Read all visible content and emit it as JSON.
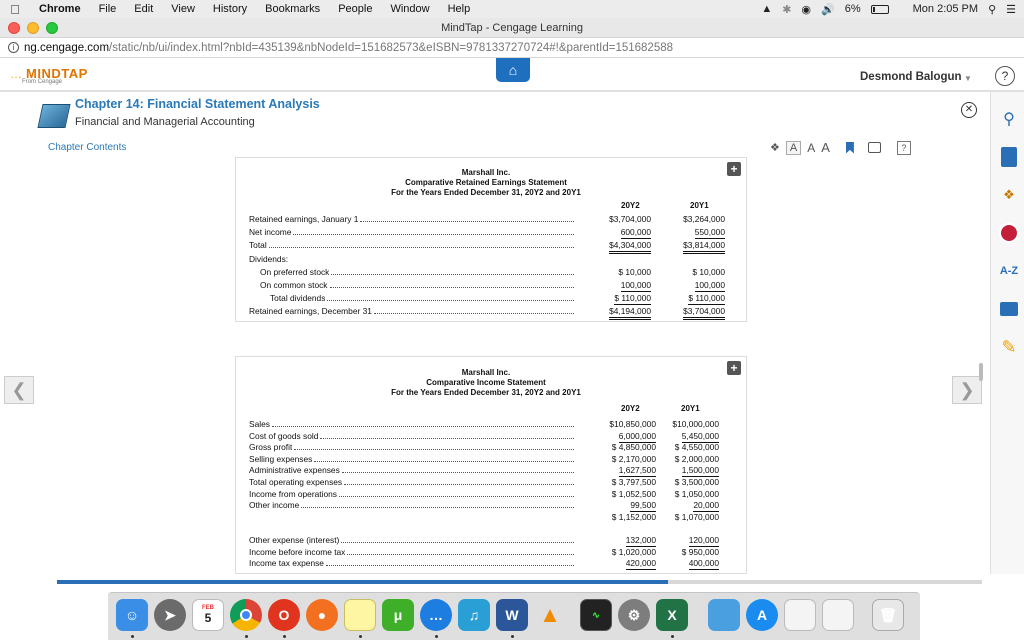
{
  "menubar": {
    "app": "Chrome",
    "items": [
      "File",
      "Edit",
      "View",
      "History",
      "Bookmarks",
      "People",
      "Window",
      "Help"
    ],
    "battery_pct": "6%",
    "clock": "Mon 2:05 PM"
  },
  "window": {
    "title": "MindTap - Cengage Learning"
  },
  "address": {
    "host": "ng.cengage.com",
    "path": "/static/nb/ui/index.html?nbId=435139&nbNodeId=151682573&eISBN=9781337270724#!&parentId=151682588"
  },
  "header": {
    "logo": "MINDTAP",
    "logo_sub": "From Cengage",
    "user": "Desmond Balogun",
    "help": "?"
  },
  "chapter": {
    "title": "Chapter 14: Financial Statement Analysis",
    "subtitle": "Financial and Managerial Accounting",
    "contents_link": "Chapter Contents"
  },
  "reader": {
    "font_sizes": [
      "A",
      "A",
      "A"
    ],
    "help": "?"
  },
  "retained": {
    "company": "Marshall Inc.",
    "title": "Comparative Retained Earnings Statement",
    "period": "For the Years Ended December 31, 20Y2 and 20Y1",
    "col1": "20Y2",
    "col2": "20Y1",
    "rows": [
      {
        "label": "Retained earnings, January 1",
        "v1": "$3,704,000",
        "v2": "$3,264,000"
      },
      {
        "label": "Net income",
        "v1": "600,000",
        "v2": "550,000"
      },
      {
        "label": "Total",
        "v1": "$4,304,000",
        "v2": "$3,814,000"
      },
      {
        "label": "Dividends:",
        "v1": "",
        "v2": ""
      },
      {
        "label": "On preferred stock",
        "v1": "$      10,000",
        "v2": "$      10,000"
      },
      {
        "label": "On common stock",
        "v1": "100,000",
        "v2": "100,000"
      },
      {
        "label": "Total dividends",
        "v1": "$   110,000",
        "v2": "$   110,000"
      },
      {
        "label": "Retained earnings, December 31",
        "v1": "$4,194,000",
        "v2": "$3,704,000"
      }
    ]
  },
  "income": {
    "company": "Marshall Inc.",
    "title": "Comparative Income Statement",
    "period": "For the Years Ended December 31, 20Y2 and 20Y1",
    "col1": "20Y2",
    "col2": "20Y1",
    "rows": [
      {
        "label": "Sales",
        "v1": "$10,850,000",
        "v2": "$10,000,000"
      },
      {
        "label": "Cost of goods sold",
        "v1": "6,000,000",
        "v2": "5,450,000"
      },
      {
        "label": "Gross profit",
        "v1": "$ 4,850,000",
        "v2": "$ 4,550,000"
      },
      {
        "label": "Selling expenses",
        "v1": "$ 2,170,000",
        "v2": "$ 2,000,000"
      },
      {
        "label": "Administrative expenses",
        "v1": "1,627,500",
        "v2": "1,500,000"
      },
      {
        "label": "Total operating expenses",
        "v1": "$ 3,797,500",
        "v2": "$ 3,500,000"
      },
      {
        "label": "Income from operations",
        "v1": "$ 1,052,500",
        "v2": "$ 1,050,000"
      },
      {
        "label": "Other income",
        "v1": "99,500",
        "v2": "20,000"
      },
      {
        "label": "",
        "v1": "$  1,152,000",
        "v2": "$ 1,070,000"
      },
      {
        "label": "",
        "v1": "",
        "v2": ""
      },
      {
        "label": "Other expense (interest)",
        "v1": "132,000",
        "v2": "120,000"
      },
      {
        "label": "Income before income tax",
        "v1": "$  1,020,000",
        "v2": "$    950,000"
      },
      {
        "label": "Income tax expense",
        "v1": "420,000",
        "v2": "400,000"
      }
    ]
  },
  "progress": {
    "fraction": 0.66
  },
  "dock": {
    "calendar_month": "FEB",
    "calendar_day": "5"
  },
  "side_apps": {
    "az": "A-Z"
  }
}
